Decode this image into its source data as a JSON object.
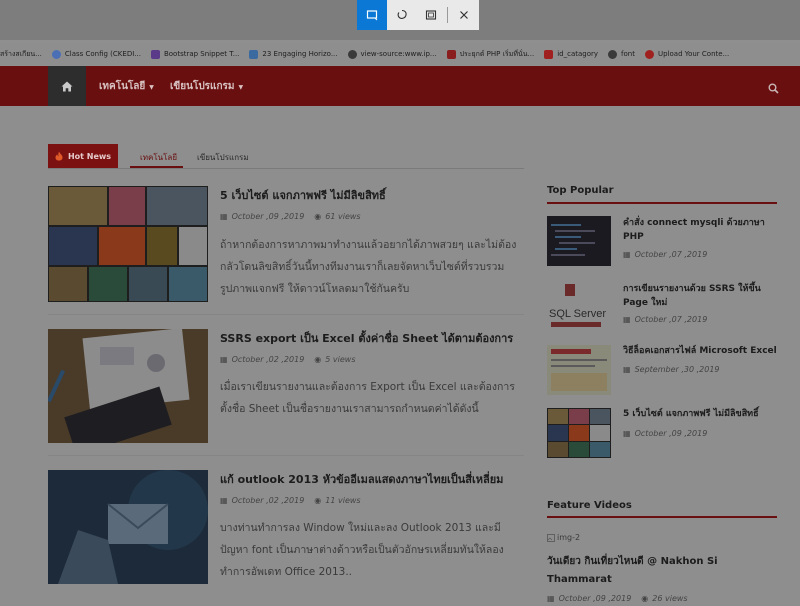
{
  "bookmarks": [
    {
      "label": "สร้างสเกียน...",
      "color": "#c9a227"
    },
    {
      "label": "Class Config (CKEDI...",
      "color": "#4a6fb5"
    },
    {
      "label": "Bootstrap Snippet T...",
      "color": "#5b3a8a"
    },
    {
      "label": "23 Engaging Horizo...",
      "color": "#3a6aa0"
    },
    {
      "label": "view-source:www.ip...",
      "color": "#3a3a3a"
    },
    {
      "label": "ประยุกต์ PHP เริ่มที่นั่น...",
      "color": "#8a1e1e"
    },
    {
      "label": "id_catagory",
      "color": "#a02020"
    },
    {
      "label": "font",
      "color": "#3a3a3a"
    },
    {
      "label": "Upload Your Conte...",
      "color": "#a02020"
    }
  ],
  "nav": {
    "items": [
      "เทคโนโลยี",
      "เขียนโปรแกรม"
    ]
  },
  "tabs": {
    "hot_label": "Hot News",
    "items": [
      "เทคโนโลยี",
      "เขียนโปรแกรม"
    ]
  },
  "posts": [
    {
      "title": "5 เว็บไซต์ แจกภาพฟรี ไม่มีลิขสิทธิ์",
      "date": "October ,09 ,2019",
      "views": "61 views",
      "excerpt": "ถ้าหากต้องการหาภาพมาทำงานแล้วอยากได้ภาพสวยๆ และไม่ต้องกลัวโดนลิขสิทธิ์วันนี้ทางทีมงานเราก็เลยจัดหาเว็บไซต์ที่รวบรวมรูปภาพแจกฟรี ให้ดาวน์โหลดมาใช้กันครับ"
    },
    {
      "title": "SSRS export เป็น Excel ตั้งค่าชื่อ Sheet ได้ตามต้องการ",
      "date": "October ,02 ,2019",
      "views": "5 views",
      "excerpt": "เมื่อเราเขียนรายงานและต้องการ Export เป็น Excel และต้องการตั้งชื่อ Sheet เป็นชื่อรายงานเราสามารถกำหนดค่าได้ดังนี้"
    },
    {
      "title": "แก้ outlook 2013 หัวข้ออีเมลแสดงภาษาไทยเป็นสี่เหลี่ยม",
      "date": "October ,02 ,2019",
      "views": "11 views",
      "excerpt": "บางท่านทำการลง Window ใหม่และลง Outlook 2013 และมีปัญหา font เป็นภาษาต่างด้าวหรือเป็นตัวอักษรเหลี่ยมทันให้ลองทำการอัพเดท Office 2013.."
    }
  ],
  "sidebar": {
    "popular_title": "Top Popular",
    "popular": [
      {
        "title": "คำสั่ง connect mysqli ด้วยภาษา PHP",
        "date": "October ,07 ,2019",
        "thumb_text": ""
      },
      {
        "title": "การเขียนรายงานด้วย SSRS ให้ขึ้น Page ใหม่",
        "date": "October ,07 ,2019",
        "thumb_text": "SQL Server"
      },
      {
        "title": "วิธีล็อคเอกสารไฟล์ Microsoft Excel",
        "date": "September ,30 ,2019",
        "thumb_text": ""
      },
      {
        "title": "5 เว็บไซต์ แจกภาพฟรี ไม่มีลิขสิทธิ์",
        "date": "October ,09 ,2019",
        "thumb_text": ""
      }
    ],
    "videos_title": "Feature Videos",
    "video": {
      "img_alt": "img-2",
      "title": "วันเดียว กินเที่ยวไหนดี @ Nakhon Si Thammarat",
      "date": "October ,09 ,2019",
      "views": "26 views"
    }
  }
}
